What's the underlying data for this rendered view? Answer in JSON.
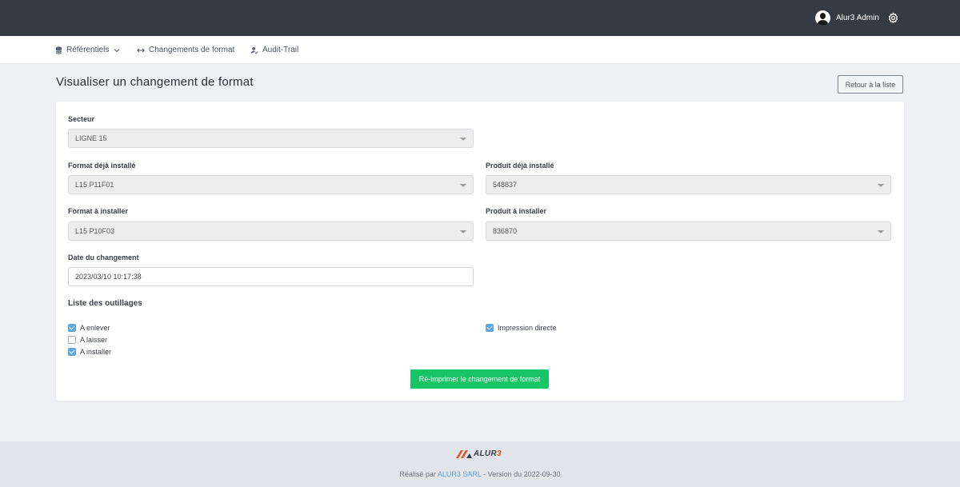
{
  "topbar": {
    "user_name": "Alur3 Admin"
  },
  "nav": {
    "items": [
      {
        "label": "Référentiels"
      },
      {
        "label": "Changements de format"
      },
      {
        "label": "Audit-Trail"
      }
    ]
  },
  "page": {
    "title": "Visualiser un changement de format",
    "back_label": "Retour à la liste"
  },
  "form": {
    "secteur": {
      "label": "Secteur",
      "value": "LIGNE 15"
    },
    "format_installe": {
      "label": "Format déjà installé",
      "value": "L15 P11F01"
    },
    "produit_installe": {
      "label": "Produit déjà installé",
      "value": "548837"
    },
    "format_a_installer": {
      "label": "Format à installer",
      "value": "L15 P10F03"
    },
    "produit_a_installer": {
      "label": "Produit à installer",
      "value": "836870"
    },
    "date": {
      "label": "Date du changement",
      "value": "2023/03/10 10:17:38"
    },
    "outillages_title": "Liste des outillages",
    "checkboxes": [
      {
        "label": "A enlever",
        "checked": true
      },
      {
        "label": "A laisser",
        "checked": false
      },
      {
        "label": "A installer",
        "checked": true
      },
      {
        "label": "Impression directe",
        "checked": true
      }
    ],
    "print_label": "Ré-imprimer le changement de format"
  },
  "footer": {
    "logo_main": "ALUR",
    "logo_digit": "3",
    "prefix": "Réalisé par ",
    "company": "ALUR3 SARL",
    "suffix": " - Version du 2022-09-30"
  },
  "colors": {
    "topbar": "#353b43",
    "accent_green": "#17c466",
    "checkbox_blue": "#5aa7e6",
    "logo_orange": "#e5532e"
  }
}
